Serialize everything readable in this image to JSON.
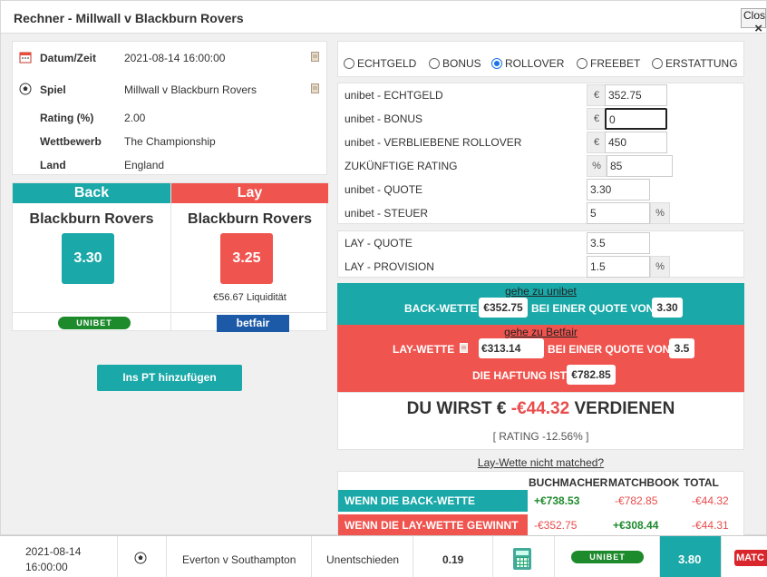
{
  "modal": {
    "title": "Rechner - Millwall v Blackburn Rovers",
    "close_label": "Close",
    "close_x": "×"
  },
  "info": {
    "rows": [
      {
        "label": "Datum/Zeit",
        "value": "2021-08-14 16:00:00",
        "icon": "calendar-icon"
      },
      {
        "label": "Spiel",
        "value": "Millwall v Blackburn Rovers",
        "icon": "soccer-ball-icon"
      },
      {
        "label": "Rating (%)",
        "value": "2.00"
      },
      {
        "label": "Wettbewerb",
        "value": "The Championship"
      },
      {
        "label": "Land",
        "value": "England"
      }
    ]
  },
  "back": {
    "header": "Back",
    "team": "Blackburn Rovers",
    "odds": "3.30",
    "bookmaker": "UNIBET"
  },
  "lay": {
    "header": "Lay",
    "team": "Blackburn Rovers",
    "odds": "3.25",
    "liquidity": "€56.67 Liquidität",
    "exchange": "betfair"
  },
  "add_pt_label": "Ins PT hinzufügen",
  "modes": [
    {
      "label": "ECHTGELD",
      "checked": false
    },
    {
      "label": "BONUS",
      "checked": false
    },
    {
      "label": "ROLLOVER",
      "checked": true
    },
    {
      "label": "FREEBET",
      "checked": false
    },
    {
      "label": "ERSTATTUNG",
      "checked": false
    }
  ],
  "form": {
    "real_money": {
      "label": "unibet - ECHTGELD",
      "prefix": "€",
      "value": "352.75"
    },
    "bonus": {
      "label": "unibet - BONUS",
      "prefix": "€",
      "value": "0"
    },
    "rollover": {
      "label": "unibet - VERBLIEBENE ROLLOVER",
      "prefix": "€",
      "value": "450"
    },
    "future_rating": {
      "label": "ZUKÜNFTIGE RATING",
      "prefix": "%",
      "value": "85"
    },
    "quote": {
      "label": "unibet - QUOTE",
      "value": "3.30"
    },
    "tax": {
      "label": "unibet - STEUER",
      "value": "5",
      "suffix": "%"
    },
    "lay_quote": {
      "label": "LAY - QUOTE",
      "value": "3.5"
    },
    "lay_commission": {
      "label": "LAY - PROVISION",
      "value": "1.5",
      "suffix": "%"
    }
  },
  "back_bet": {
    "link": "gehe zu unibet",
    "label": "BACK-WETTE",
    "amount": "€352.75",
    "at_odds_label": "BEI EINER QUOTE VON",
    "odds": "3.30"
  },
  "lay_bet": {
    "link": "gehe zu Betfair",
    "label": "LAY-WETTE",
    "amount": "€313.14",
    "at_odds_label": "BEI EINER QUOTE VON",
    "odds": "3.5",
    "liability_label": "DIE HAFTUNG IST",
    "liability": "€782.85"
  },
  "result": {
    "prefix": "DU WIRST €",
    "amount": "-€44.32",
    "suffix": "VERDIENEN",
    "rating": "[ RATING -12.56% ]"
  },
  "not_matched": "Lay-Wette nicht matched?",
  "summary": {
    "headers": [
      "BUCHMACHER",
      "MATCHBOOK",
      "TOTAL"
    ],
    "rows": [
      {
        "label": "WENN DIE BACK-WETTE GEWINNT",
        "bookmaker": "+€738.53",
        "exchange": "-€782.85",
        "total": "-€44.32"
      },
      {
        "label": "WENN DIE LAY-WETTE GEWINNT",
        "bookmaker": "-€352.75",
        "exchange": "+€308.44",
        "total": "-€44.31"
      }
    ]
  },
  "bottom": {
    "date": "2021-08-14",
    "time": "16:00:00",
    "match": "Everton v Southampton",
    "selection": "Unentschieden",
    "rating": "0.19",
    "bookmaker": "UNIBET",
    "odds": "3.80",
    "exchange": "MATC"
  },
  "colors": {
    "back": "#1aa8a8",
    "lay": "#f0544f",
    "positive": "#1d8a2c",
    "negative": "#e84c4c"
  }
}
